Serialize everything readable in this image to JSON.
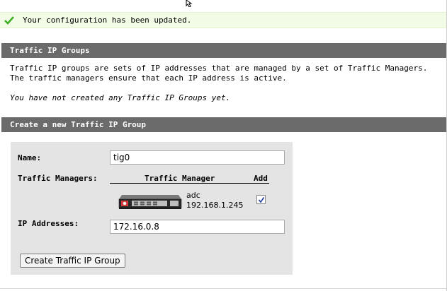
{
  "notification": {
    "message": "Your configuration has been updated.",
    "icon": "check-icon",
    "color": "#3cae1f"
  },
  "tig_section": {
    "title": "Traffic IP Groups",
    "description": "Traffic IP groups are sets of IP addresses that are managed by a set of Traffic Managers. The traffic managers ensure that each IP address is active.",
    "empty_message": "You have not created any Traffic IP Groups yet."
  },
  "create_section": {
    "title": "Create a new Traffic IP Group",
    "name_label": "Name:",
    "name_value": "tig0",
    "traffic_managers_label": "Traffic Managers:",
    "table_headers": {
      "manager": "Traffic Manager",
      "add": "Add"
    },
    "managers": [
      {
        "name": "adc",
        "ip": "192.168.1.245",
        "checked": true,
        "icon": "appliance-icon"
      }
    ],
    "ip_label": "IP Addresses:",
    "ip_value": "172.16.0.8",
    "submit_label": "Create Traffic IP Group"
  },
  "colors": {
    "header_bg": "#6b6b6b",
    "success_bg": "#f2fbe6",
    "form_bg": "#e4e4e4"
  }
}
